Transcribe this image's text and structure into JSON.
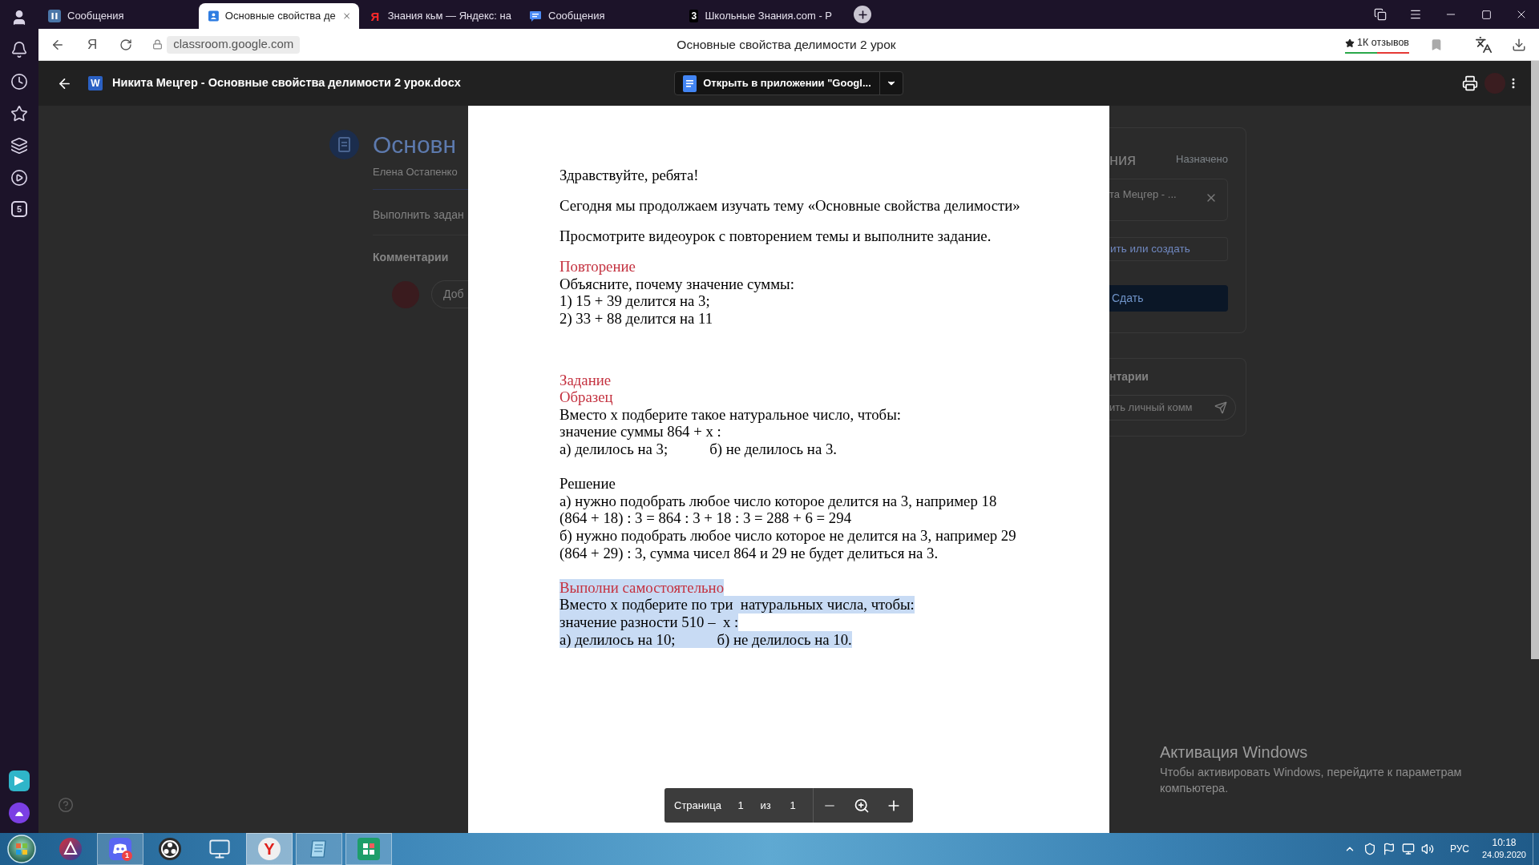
{
  "tabs": [
    {
      "kind": "messages",
      "title": "Сообщения",
      "selected": false
    },
    {
      "kind": "classroom",
      "title": "Основные свойства де",
      "selected": true
    },
    {
      "kind": "letter",
      "icon_glyph": "Я",
      "title": "Знания кьм — Яндекс: на",
      "selected": false
    },
    {
      "kind": "chat",
      "title": "Сообщения",
      "selected": false
    },
    {
      "kind": "tile",
      "icon_glyph": "3",
      "title": "Школьные Знания.com - Р",
      "selected": false
    }
  ],
  "address_bar": {
    "home_glyph": "Я",
    "url": "classroom.google.com",
    "page_title": "Основные свойства делимости 2 урок",
    "reviews": "1К отзывов"
  },
  "sidebar": {
    "counter": "5"
  },
  "viewer": {
    "file_glyph": "W",
    "file_name": "Никита Мецгер - Основные свойства делимости 2 урок.docx",
    "open_button": "Открыть в приложении \"Googl...",
    "toolbar": {
      "page_label": "Страница",
      "current_page": "1",
      "of_label": "из",
      "total_pages": "1"
    }
  },
  "background_page": {
    "left": {
      "title": "Основн",
      "author": "Елена Остапенко",
      "task": "Выполнить задан",
      "comments_heading": "Комментарии",
      "comment_placeholder": "Доб"
    },
    "right": {
      "heading": "ния",
      "status": "Назначено",
      "attachment": "та Мецгер - ...",
      "add_button": "ить или создать",
      "submit_button": "Сдать",
      "comments_heading": "нтарии",
      "comment_placeholder": "ить личный комм"
    }
  },
  "document": {
    "paragraphs": [
      {
        "lines": [
          {
            "kind": "text",
            "text": "Здравствуйте, ребята!",
            "highlighted": false
          }
        ]
      },
      {
        "lines": [
          {
            "kind": "text",
            "text": "Сегодня мы продолжаем изучать тему «Основные свойства делимости»",
            "highlighted": false
          }
        ]
      },
      {
        "lines": [
          {
            "kind": "text",
            "text": "Просмотрите видеоурок с повторением темы и выполните задание.",
            "highlighted": false
          }
        ]
      },
      {
        "lines": [
          {
            "kind": "heading",
            "text": "Повторение",
            "highlighted": false
          },
          {
            "kind": "text",
            "text": "Объясните, почему значение суммы:",
            "highlighted": false
          },
          {
            "kind": "text",
            "text": "1) 15 + 39 делится на 3;",
            "highlighted": false
          },
          {
            "kind": "text",
            "text": "2) 33 + 88 делится на 11",
            "highlighted": false
          }
        ]
      },
      {
        "lines": [
          {
            "kind": "heading",
            "text": "Задание",
            "highlighted": false
          },
          {
            "kind": "heading",
            "text": "Образец",
            "highlighted": false
          },
          {
            "kind": "text",
            "text": "Вместо х подберите такое натуральное число, чтобы:",
            "highlighted": false
          },
          {
            "kind": "text",
            "text": "значение суммы 864 + х :",
            "highlighted": false
          },
          {
            "kind": "columns",
            "parts": [
              "а) делилось на 3;",
              "б) не делилось на 3."
            ],
            "highlighted": false
          }
        ]
      },
      {
        "lines": [
          {
            "kind": "text",
            "text": "Решение",
            "highlighted": false
          },
          {
            "kind": "text",
            "text": "а) нужно подобрать любое число которое делится на 3, например 18",
            "highlighted": false
          },
          {
            "kind": "text",
            "text": "(864 + 18) : 3 = 864 : 3 + 18 : 3 = 288 + 6 = 294",
            "highlighted": false
          },
          {
            "kind": "text",
            "text": "б) нужно подобрать любое число которое не делится на 3, например 29",
            "highlighted": false
          },
          {
            "kind": "text",
            "text": "(864 + 29) : 3, сумма чисел 864 и 29 не будет делиться на 3.",
            "highlighted": false
          }
        ]
      },
      {
        "lines": [
          {
            "kind": "heading",
            "text": "Выполни самостоятельно",
            "highlighted": true
          },
          {
            "kind": "text",
            "text": "Вместо х подберите по три  натуральных числа, чтобы:",
            "highlighted": true
          },
          {
            "kind": "text",
            "text": "значение разности 510 –  х :",
            "highlighted": true
          },
          {
            "kind": "columns",
            "parts": [
              "а) делилось на 10;",
              "б) не делилось на 10."
            ],
            "highlighted": true
          }
        ]
      }
    ]
  },
  "activation_notice": {
    "title": "Активация Windows",
    "text": "Чтобы активировать Windows, перейдите к параметрам компьютера."
  },
  "taskbar": {
    "apps": [
      {
        "kind": "ring",
        "running": false,
        "selected": false
      },
      {
        "kind": "controller",
        "running": true,
        "selected": false,
        "badge": "1"
      },
      {
        "kind": "aperture",
        "running": false,
        "selected": false
      },
      {
        "kind": "monitor",
        "running": false,
        "selected": false
      },
      {
        "kind": "letter",
        "glyph": "Y",
        "running": true,
        "selected": true
      },
      {
        "kind": "notebook",
        "running": true,
        "selected": false
      },
      {
        "kind": "store",
        "running": true,
        "selected": false
      }
    ],
    "language": "РУС",
    "time": "10:18",
    "date": "24.09.2020"
  }
}
